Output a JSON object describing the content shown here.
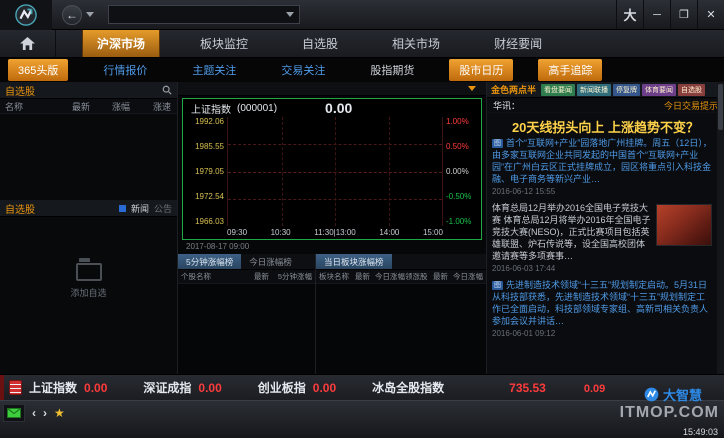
{
  "titlebar": {
    "back_icon": "←",
    "combo_value": "",
    "font_button": "大",
    "minimize_button": "─",
    "maximize_button": "❐",
    "close_button": "✕"
  },
  "main_nav": {
    "tabs": [
      {
        "label": "沪深市场"
      },
      {
        "label": "板块监控"
      },
      {
        "label": "自选股"
      },
      {
        "label": "相关市场"
      },
      {
        "label": "财经要闻"
      }
    ]
  },
  "sub_nav": {
    "tabs": [
      {
        "label": "365头版"
      },
      {
        "label": "行情报价"
      },
      {
        "label": "主题关注"
      },
      {
        "label": "交易关注"
      },
      {
        "label": "股指期货"
      },
      {
        "label": "股市日历"
      },
      {
        "label": "高手追踪"
      }
    ]
  },
  "watchlist": {
    "title": "自选股",
    "columns": [
      "名称",
      "最新",
      "涨幅",
      "涨速"
    ],
    "news_section_title": "自选股",
    "tab_news": "新闻",
    "tab_notice": "公告",
    "add_label": "添加自选"
  },
  "chart": {
    "name": "上证指数",
    "code": "(000001)",
    "price": "0.00",
    "left_axis": [
      "1992.06",
      "1985.55",
      "1979.05",
      "1972.54",
      "1966.03"
    ],
    "right_axis": [
      "1.00%",
      "0.50%",
      "0.00%",
      "-0.50%",
      "-1.00%"
    ],
    "times": [
      "09:30",
      "10:30",
      "11:30|13:00",
      "14:00",
      "15:00"
    ],
    "date_label": "2017-08-17 09:00"
  },
  "rank_left": {
    "tab_active": "5分钟涨幅榜",
    "tab_inactive": "今日涨幅榜",
    "columns": [
      "个股名称",
      "最新",
      "5分钟涨幅"
    ]
  },
  "rank_right": {
    "tab_active": "当日板块涨幅榜",
    "columns": [
      "板块名称",
      "最新",
      "今日涨幅",
      "领涨股",
      "最新",
      "今日涨幅"
    ]
  },
  "news": {
    "column_title": "金色两点半",
    "tags": [
      "看盘要闻",
      "新闻联播",
      "停复牌",
      "体育要闻",
      "自选股"
    ],
    "tip_prefix": "华讯：",
    "tip_link": "今日交易提示",
    "headline": "20天线拐头向上 上涨趋势不变？",
    "items": [
      {
        "tag": "图",
        "text": "首个“互联网+产业”园落地广州挂牌。周五（12日），由多家互联网企业共同发起的中国首个“互联网+产业园”在广州白云区正式挂牌成立，园区将重点引入科技金融、电子商务等新兴产业…",
        "time": "2016-06-12 15:55"
      },
      {
        "text": "体育总局12月举办2016全国电子竞技大赛 体育总局12月将举办2016年全国电子竞技大赛(NESO)，正式比赛项目包括英雄联盟、炉石传说等，设全国高校团体邀请赛等多项赛事…",
        "time": "2016-06-03 17:44"
      },
      {
        "tag": "图",
        "text": "先进制造技术领域“十三五”规划制定启动。5月31日从科技部获悉，先进制造技术领域“十三五”规划制定工作已全面启动，科技部领域专家组、高新司相关负责人参加会议并讲话…",
        "time": "2016-06-01 09:12"
      }
    ]
  },
  "ticker": {
    "items": [
      {
        "label": "上证指数",
        "value": "0.00"
      },
      {
        "label": "深证成指",
        "value": "0.00"
      },
      {
        "label": "创业板指",
        "value": "0.00"
      },
      {
        "label": "冰岛全股指数",
        "value": "735.53",
        "change": "0.09"
      }
    ]
  },
  "taskbar": {
    "nav_prev": "‹",
    "nav_next": "›",
    "star": "★",
    "brand": "大智慧",
    "watermark": "ITMOP.COM",
    "time": "15:49:03"
  }
}
